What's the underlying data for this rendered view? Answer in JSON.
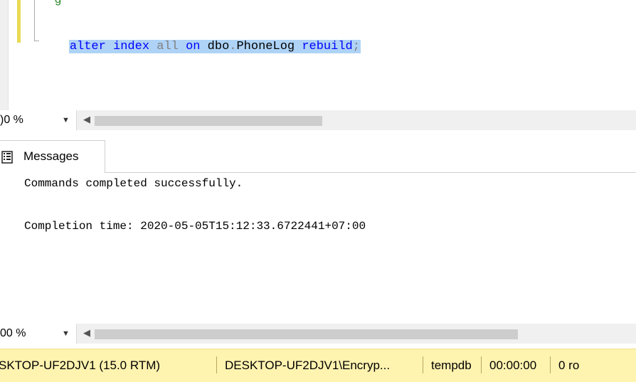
{
  "editor": {
    "lines": [
      {
        "text": "--g"
      },
      {
        "tokens": [
          {
            "text": "alter",
            "kind": "keyword"
          },
          {
            "text": " ",
            "kind": "plain"
          },
          {
            "text": "index",
            "kind": "keyword"
          },
          {
            "text": " ",
            "kind": "plain"
          },
          {
            "text": "all",
            "kind": "gray"
          },
          {
            "text": " ",
            "kind": "plain"
          },
          {
            "text": "on",
            "kind": "keyword"
          },
          {
            "text": " ",
            "kind": "plain"
          },
          {
            "text": "dbo",
            "kind": "plain"
          },
          {
            "text": ".",
            "kind": "gray"
          },
          {
            "text": "PhoneLog",
            "kind": "plain"
          },
          {
            "text": " ",
            "kind": "plain"
          },
          {
            "text": "rebuild",
            "kind": "keyword"
          },
          {
            "text": ";",
            "kind": "gray"
          }
        ]
      }
    ]
  },
  "editor_zoom": {
    "value": ")0 %"
  },
  "results_zoom": {
    "value": "00 %"
  },
  "results": {
    "tab_label": "Messages",
    "messages": [
      "Commands completed successfully.",
      "Completion time: 2020-05-05T15:12:33.6722441+07:00"
    ]
  },
  "status": {
    "server": "SKTOP-UF2DJV1 (15.0 RTM)",
    "login": "DESKTOP-UF2DJV1\\Encryp...",
    "database": "tempdb",
    "elapsed": "00:00:00",
    "rows": "0 ro"
  },
  "colors": {
    "keyword": "#0000ff",
    "gray": "#808080",
    "comment": "#2e8b2e",
    "selection": "#aed3f6",
    "statusbar": "#fff3b0"
  },
  "icons": {
    "zoom_dropdown": "chevron-down-icon",
    "scroll_left": "scroll-left-arrow-icon",
    "messages_tab": "messages-icon"
  }
}
